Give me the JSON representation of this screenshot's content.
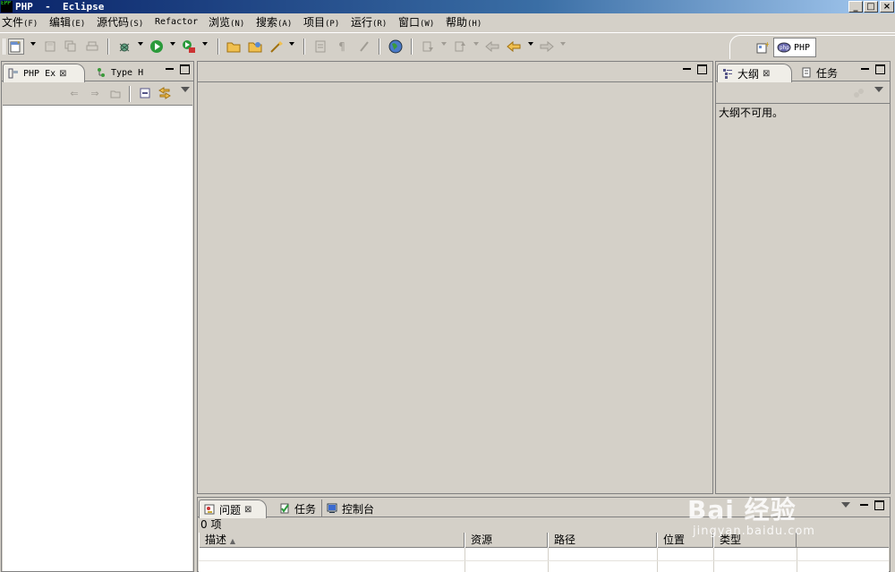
{
  "window": {
    "app_icon_text": "EPP",
    "title": "PHP  -  Eclipse",
    "buttons": {
      "minimize": "_",
      "maximize": "□",
      "close": "×"
    }
  },
  "menu": [
    {
      "label": "文件",
      "accel": "(F)"
    },
    {
      "label": "编辑",
      "accel": "(E)"
    },
    {
      "label": "源代码",
      "accel": "(S)"
    },
    {
      "label": "Refactor",
      "accel": ""
    },
    {
      "label": "浏览",
      "accel": "(N)"
    },
    {
      "label": "搜索",
      "accel": "(A)"
    },
    {
      "label": "项目",
      "accel": "(P)"
    },
    {
      "label": "运行",
      "accel": "(R)"
    },
    {
      "label": "窗口",
      "accel": "(W)"
    },
    {
      "label": "帮助",
      "accel": "(H)"
    }
  ],
  "perspective": {
    "active_label": "PHP"
  },
  "left_panel": {
    "tabs": [
      {
        "label": "PHP Ex",
        "icon": "php-explorer-icon"
      },
      {
        "label": "Type H",
        "icon": "type-hierarchy-icon"
      }
    ]
  },
  "right_panel": {
    "tabs": [
      {
        "label": "大纲",
        "icon": "outline-icon"
      },
      {
        "label": "任务",
        "icon": "tasks-icon"
      }
    ],
    "message": "大纲不可用。"
  },
  "bottom_panel": {
    "tabs": [
      {
        "label": "问题",
        "icon": "problems-icon"
      },
      {
        "label": "任务",
        "icon": "tasks-icon"
      },
      {
        "label": "控制台",
        "icon": "console-icon"
      }
    ],
    "count_text": "0 项",
    "columns": [
      "描述",
      "资源",
      "路径",
      "位置",
      "类型"
    ]
  },
  "watermark": {
    "main": "Bai 经验",
    "sub": "jingyan.baidu.com"
  }
}
